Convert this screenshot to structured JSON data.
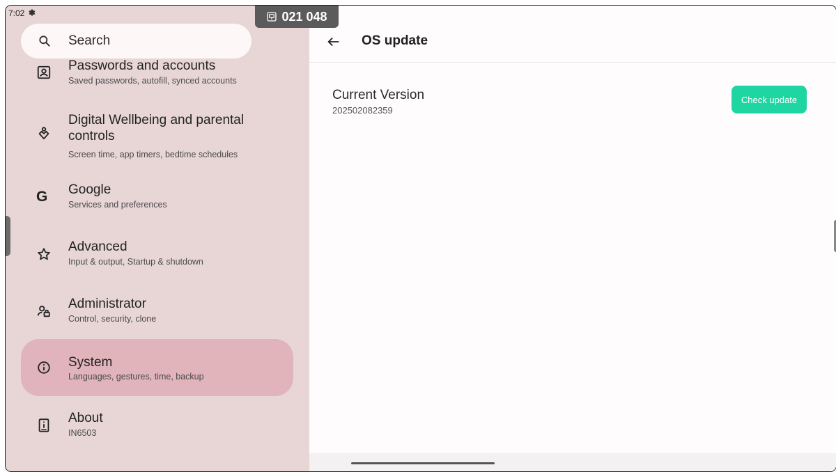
{
  "status_bar": {
    "time": "7:02",
    "settings_icon": "gear-icon"
  },
  "overlay": {
    "code": "021 048",
    "icon": "screen-share-icon"
  },
  "search": {
    "placeholder": "Search",
    "icon": "search-icon"
  },
  "sidebar": {
    "items": [
      {
        "title": "Passwords and accounts",
        "subtitle": "Saved passwords, autofill, synced accounts",
        "icon": "account-box-icon",
        "selected": false
      },
      {
        "title_lines": [
          "Digital Wellbeing and parental",
          "controls"
        ],
        "subtitle": "Screen time, app timers, bedtime schedules",
        "icon": "wellbeing-icon",
        "selected": false
      },
      {
        "title": "Google",
        "subtitle": "Services and preferences",
        "icon": "google-icon",
        "selected": false
      },
      {
        "title": "Advanced",
        "subtitle": "Input & output, Startup & shutdown",
        "icon": "star-outline-icon",
        "selected": false
      },
      {
        "title": "Administrator",
        "subtitle": "Control, security, clone",
        "icon": "admin-lock-icon",
        "selected": false
      },
      {
        "title": "System",
        "subtitle": "Languages, gestures, time, backup",
        "icon": "info-icon",
        "selected": true
      },
      {
        "title": "About",
        "subtitle": "IN6503",
        "icon": "device-info-icon",
        "selected": false
      }
    ]
  },
  "detail": {
    "back_icon": "arrow-back-icon",
    "title": "OS update",
    "current_version_label": "Current Version",
    "current_version_value": "202502082359",
    "check_update_label": "Check update",
    "accent_color": "#1fd6a2"
  },
  "colors": {
    "sidebar_bg": "#e8d6d7",
    "selected_bg": "#e1b4bc",
    "panel_bg": "#fefcfc"
  }
}
